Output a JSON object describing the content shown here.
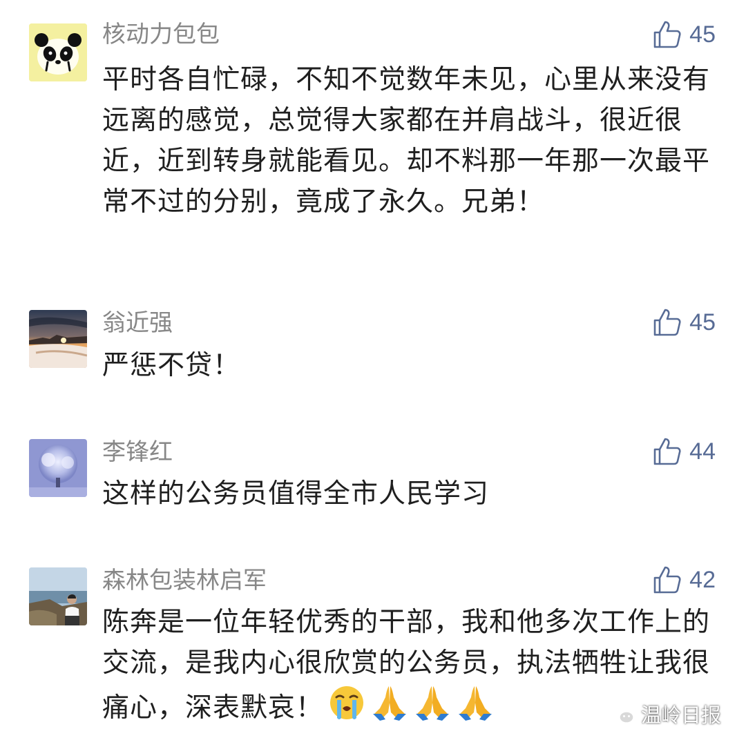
{
  "comments": [
    {
      "author": "核动力包包",
      "likes": "45",
      "avatar_icon": "panda-avatar-icon",
      "text": "平时各自忙碌，不知不觉数年未见，心里从来没有远离的感觉，总觉得大家都在并肩战斗，很近很近，近到转身就能看见。却不料那一年那一次最平常不过的分别，竟成了永久。兄弟！"
    },
    {
      "author": "翁近强",
      "likes": "45",
      "avatar_icon": "sunset-landscape-avatar-icon",
      "text": "严惩不贷！"
    },
    {
      "author": "李锋红",
      "likes": "44",
      "avatar_icon": "blossom-tree-avatar-icon",
      "text": "这样的公务员值得全市人民学习"
    },
    {
      "author": "森林包装林启军",
      "likes": "42",
      "avatar_icon": "man-by-sea-avatar-icon",
      "text": "陈奔是一位年轻优秀的干部，我和他多次工作上的交流，是我内心很欣赏的公务员，执法牺牲让我很痛心，深表默哀！",
      "emojis": [
        "crying-face-emoji",
        "folded-hands-emoji",
        "folded-hands-emoji",
        "folded-hands-emoji"
      ]
    }
  ],
  "watermark": {
    "text": "温岭日报",
    "icon": "wechat-logo-icon"
  },
  "colors": {
    "name": "#878787",
    "like": "#576b95",
    "text": "#1f1f1f"
  }
}
